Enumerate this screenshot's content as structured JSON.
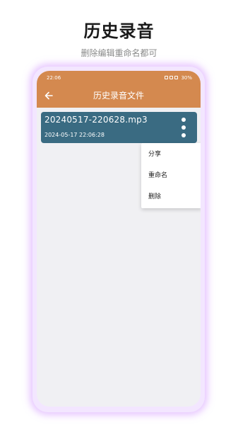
{
  "promo": {
    "title": "历史录音",
    "subtitle": "删除编辑重命名都可"
  },
  "statusbar": {
    "time": "22:06",
    "battery": "30%"
  },
  "appbar": {
    "title": "历史录音文件"
  },
  "files": [
    {
      "name": "20240517-220628.mp3",
      "date": "2024-05-17 22:06:28"
    }
  ],
  "menu": {
    "items": [
      "分享",
      "重命名",
      "删除"
    ]
  },
  "colors": {
    "appbar": "#d4894f",
    "card": "#3a6b82",
    "background": "#f0f0f3"
  }
}
